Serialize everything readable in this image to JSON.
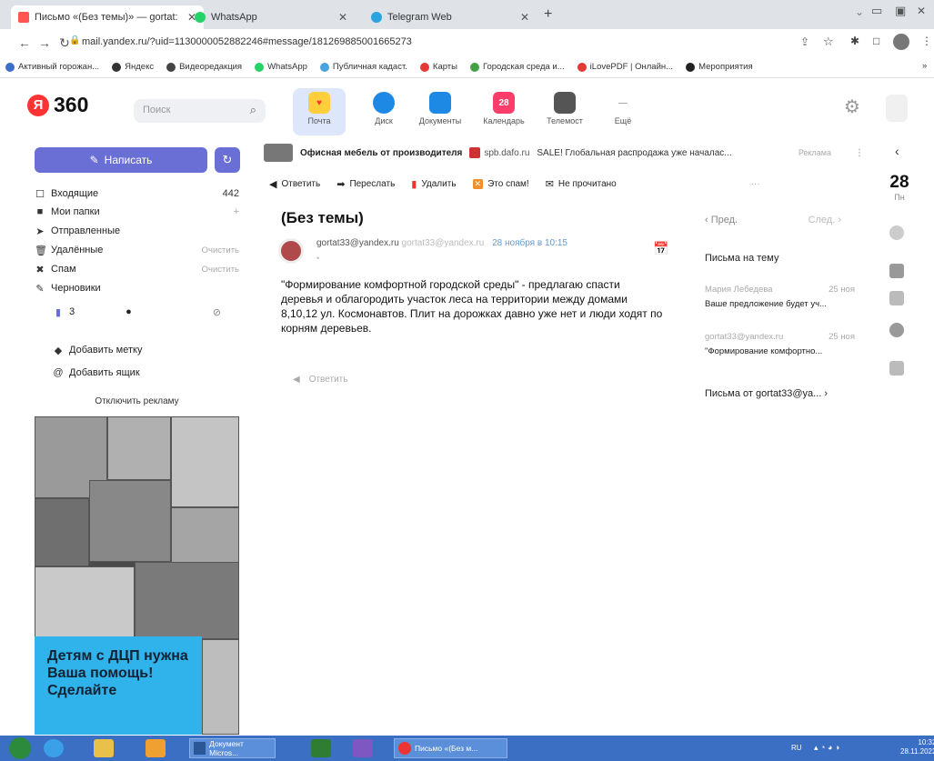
{
  "browser": {
    "tabs": [
      {
        "title": "Письмо «(Без темы)» — gortat:",
        "active": true
      },
      {
        "title": "WhatsApp",
        "active": false
      },
      {
        "title": "Telegram Web",
        "active": false
      }
    ],
    "new_tab": "+",
    "url": "mail.yandex.ru/?uid=1130000052882246#message/181269885001665273",
    "bookmarks": [
      "Активный горожан...",
      "Яндекс",
      "Видеоредакция",
      "WhatsApp",
      "Публичная кадаст.",
      "Карты",
      "Городская среда и...",
      "iLovePDF | Онлайн...",
      "Мероприятия"
    ],
    "bookmarks_more": "»"
  },
  "header": {
    "logo_text": "360",
    "search_placeholder": "Поиск",
    "services": [
      {
        "label": "Почта",
        "color": "#ff5a5a"
      },
      {
        "label": "Диск",
        "color": "#1e88e5"
      },
      {
        "label": "Документы",
        "color": "#1e88e5"
      },
      {
        "label": "Календарь",
        "color": "#ff3d6a",
        "badge": "28"
      },
      {
        "label": "Телемост",
        "color": "#555"
      },
      {
        "label": "Ещё",
        "color": "#ccc"
      }
    ]
  },
  "sidebar": {
    "compose_label": "Написать",
    "folders": [
      {
        "label": "Входящие",
        "count": "442",
        "action": "",
        "icon": "☐"
      },
      {
        "label": "Мои папки",
        "count": "+",
        "action": "",
        "icon": "■"
      },
      {
        "label": "Отправленные",
        "count": "",
        "action": "",
        "icon": "➤"
      },
      {
        "label": "Удалённые",
        "count": "",
        "action": "Очистить",
        "icon": "🗑"
      },
      {
        "label": "Спам",
        "count": "",
        "action": "Очистить",
        "icon": "✖"
      },
      {
        "label": "Черновики",
        "count": "",
        "action": "",
        "icon": "✎"
      }
    ],
    "labels_count": "3",
    "add_label": "Добавить метку",
    "add_mailbox": "Добавить ящик",
    "disable_ads": "Отключить рекламу",
    "ad_text": "Детям с ДЦП нужна Ваша помощь! Сделайте"
  },
  "top_ad": {
    "title": "Офисная мебель от производителя",
    "domain": "spb.dafo.ru",
    "text": "SALE! Глобальная распродажа уже началас...",
    "label": "Реклама"
  },
  "toolbar": {
    "reply": "Ответить",
    "forward": "Переслать",
    "delete": "Удалить",
    "spam": "Это спам!",
    "unread": "Не прочитано",
    "more": "···"
  },
  "message": {
    "subject": "(Без темы)",
    "from": "gortat33@yandex.ru",
    "to": "gortat33@yandex.ru",
    "date": "28 ноября в 10:15",
    "body": "\"Формирование комфортной городской среды\" - предлагаю спасти деревья и облагородить участок леса на территории  между домами 8,10,12 ул. Космонавтов. Плит на дорожках давно уже нет и люди ходят по корням деревьев.",
    "reply_label": "Ответить"
  },
  "right_panel": {
    "prev": "‹ Пред.",
    "next": "След. ›",
    "thread_title": "Письма на тему",
    "thread": [
      {
        "from": "Мария Лебедева",
        "date": "25 ноя",
        "snippet": "Ваше предложение будет уч..."
      },
      {
        "from": "gortat33@yandex.ru",
        "date": "25 ноя",
        "snippet": "\"Формирование комфортно..."
      }
    ],
    "from_sender": "Письма от gortat33@ya... ›"
  },
  "day_tile": {
    "day": "28",
    "weekday": "Пн"
  },
  "taskbar": {
    "items": [
      "Документ Micros...",
      "Письмо «(Без м..."
    ],
    "time": "10:32",
    "date": "28.11.2022",
    "lang": "RU"
  }
}
